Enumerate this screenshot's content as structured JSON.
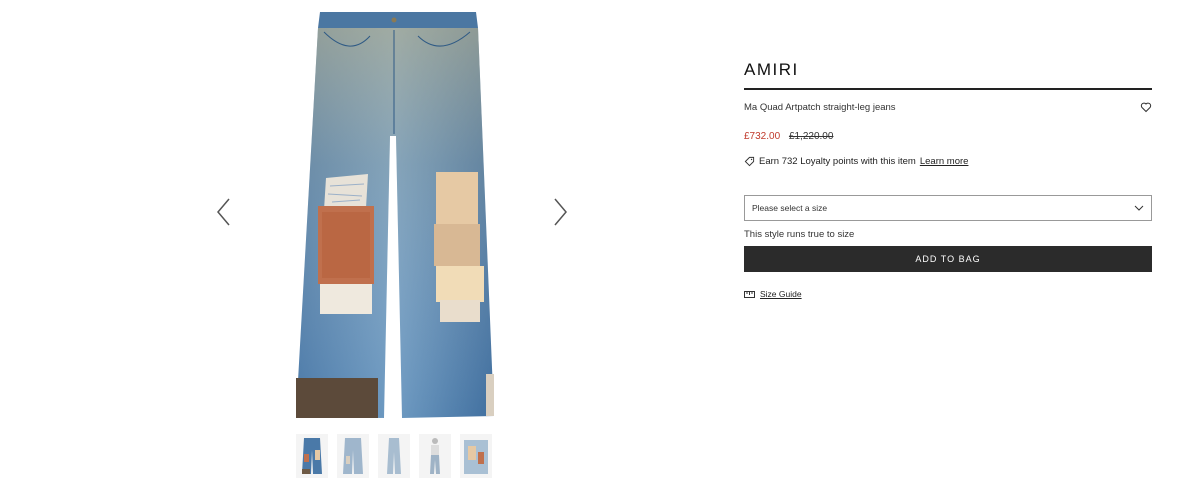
{
  "gallery": {
    "prev_icon": "chevron-left-icon",
    "next_icon": "chevron-right-icon",
    "thumbnails": [
      "thumb-front",
      "thumb-back",
      "thumb-side",
      "thumb-model",
      "thumb-detail"
    ]
  },
  "product": {
    "brand": "AMIRI",
    "name": "Ma Quad Artpatch straight-leg jeans",
    "price_sale": "£732.00",
    "price_original": "£1,220.00",
    "loyalty_text": "Earn 732 Loyalty points with this item",
    "loyalty_link": "Learn more",
    "size_placeholder": "Please select a size",
    "fit_note": "This style runs true to size",
    "add_to_bag": "ADD TO BAG",
    "size_guide": "Size Guide"
  },
  "colors": {
    "sale_price": "#c0392b",
    "button_bg": "#2b2b2b",
    "denim": "#3f6e9e"
  }
}
